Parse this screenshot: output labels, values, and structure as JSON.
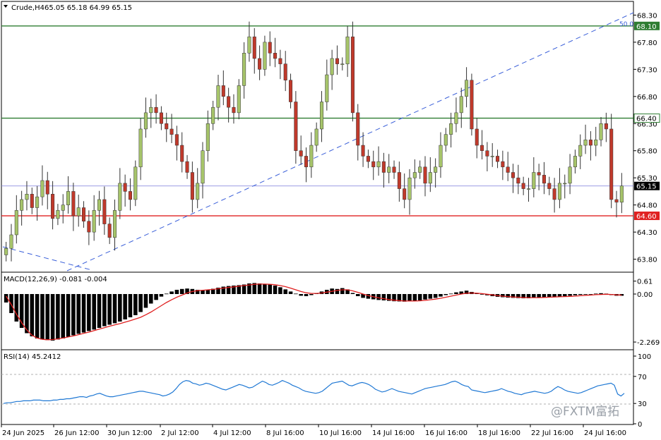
{
  "header": {
    "symbol": "Crude,H4",
    "ohlc": "65.05 65.18 64.99 65.15"
  },
  "indicators": {
    "macd_label": "MACD(12,26,9) -0.081 -0.004",
    "rsi_label": "RSI(14) 45.2412"
  },
  "watermark": "@FXTM富拓",
  "fib_label": "50.0",
  "colors": {
    "up_candle": "#a6c46a",
    "down_candle": "#c0392b",
    "green_line": "#2e7d32",
    "red_line": "#e02020",
    "price_line": "#7c7cdc",
    "trend_line": "#3a5fd9",
    "signal_line": "#e02020",
    "rsi_line": "#1f78d4"
  },
  "chart_data": [
    {
      "type": "candlestick",
      "title": "Crude,H4",
      "ylim": [
        63.6,
        68.5
      ],
      "y_ticks": [
        "68.30",
        "67.80",
        "67.30",
        "66.80",
        "66.30",
        "65.80",
        "65.30",
        "64.80",
        "64.30",
        "63.80"
      ],
      "x_ticks": [
        "24 Jun 2025",
        "26 Jun 12:00",
        "30 Jun 12:00",
        "2 Jul 12:00",
        "4 Jul 12:00",
        "8 Jul 16:00",
        "10 Jul 16:00",
        "14 Jul 16:00",
        "16 Jul 16:00",
        "18 Jul 16:00",
        "22 Jul 16:00",
        "24 Jul 16:00"
      ],
      "close_series": [
        64.0,
        64.25,
        64.7,
        64.9,
        65.0,
        64.75,
        64.95,
        65.25,
        65.0,
        64.55,
        64.7,
        64.8,
        65.05,
        64.6,
        64.75,
        64.5,
        64.3,
        64.7,
        64.9,
        64.45,
        64.2,
        64.7,
        65.2,
        65.05,
        64.9,
        65.5,
        66.2,
        66.5,
        66.6,
        66.5,
        66.3,
        66.2,
        66.1,
        65.9,
        65.6,
        65.4,
        64.9,
        65.2,
        65.8,
        66.3,
        66.6,
        67.0,
        66.8,
        66.6,
        66.5,
        67.0,
        67.6,
        67.9,
        67.5,
        67.3,
        67.8,
        67.6,
        67.5,
        67.4,
        67.1,
        66.7,
        65.8,
        65.7,
        65.5,
        65.9,
        66.2,
        66.7,
        67.2,
        67.5,
        67.4,
        67.4,
        67.9,
        66.5,
        65.9,
        65.7,
        65.6,
        65.5,
        65.6,
        65.4,
        65.5,
        65.4,
        65.1,
        64.9,
        65.3,
        65.4,
        65.5,
        65.2,
        65.4,
        65.5,
        65.9,
        66.1,
        66.3,
        66.5,
        66.8,
        67.1,
        66.2,
        65.9,
        65.8,
        65.7,
        65.7,
        65.6,
        65.5,
        65.4,
        65.3,
        65.2,
        65.1,
        65.1,
        65.4,
        65.35,
        65.2,
        65.1,
        64.9,
        65.2,
        65.2,
        65.5,
        65.7,
        65.9,
        66.0,
        65.9,
        66.0,
        66.3,
        66.2,
        64.9,
        64.85,
        65.15
      ],
      "horizontal_levels": [
        {
          "label": "68.10",
          "value": 68.1
        },
        {
          "label": "66.40",
          "value": 66.4
        },
        {
          "label": "65.15",
          "value": 65.15
        },
        {
          "label": "64.60",
          "value": 64.6
        }
      ]
    },
    {
      "type": "bar",
      "title": "MACD(12,26,9) -0.081 -0.004",
      "y_ticks": [
        "0.61",
        "0.00",
        "-2.269"
      ],
      "ylim": [
        -2.5,
        0.9
      ],
      "histogram": [
        -0.4,
        -0.9,
        -1.3,
        -1.6,
        -1.85,
        -2.0,
        -2.1,
        -2.15,
        -2.18,
        -2.2,
        -2.15,
        -2.1,
        -2.02,
        -1.95,
        -1.88,
        -1.82,
        -1.75,
        -1.68,
        -1.6,
        -1.52,
        -1.45,
        -1.38,
        -1.3,
        -1.2,
        -1.1,
        -1.0,
        -0.85,
        -0.65,
        -0.45,
        -0.28,
        -0.12,
        0.02,
        0.12,
        0.2,
        0.24,
        0.26,
        0.24,
        0.2,
        0.18,
        0.2,
        0.25,
        0.3,
        0.35,
        0.38,
        0.4,
        0.42,
        0.45,
        0.5,
        0.52,
        0.5,
        0.48,
        0.45,
        0.4,
        0.32,
        0.22,
        0.12,
        0.02,
        -0.08,
        -0.1,
        -0.05,
        0.05,
        0.12,
        0.2,
        0.26,
        0.24,
        0.28,
        0.22,
        0.05,
        -0.1,
        -0.18,
        -0.22,
        -0.25,
        -0.28,
        -0.3,
        -0.32,
        -0.34,
        -0.35,
        -0.36,
        -0.34,
        -0.32,
        -0.3,
        -0.26,
        -0.22,
        -0.18,
        -0.12,
        -0.05,
        0.02,
        0.08,
        0.12,
        0.16,
        0.1,
        0.04,
        -0.02,
        -0.06,
        -0.1,
        -0.13,
        -0.15,
        -0.17,
        -0.18,
        -0.19,
        -0.2,
        -0.2,
        -0.18,
        -0.16,
        -0.15,
        -0.14,
        -0.13,
        -0.12,
        -0.1,
        -0.08,
        -0.06,
        -0.04,
        -0.02,
        0.0,
        0.02,
        0.04,
        0.02,
        -0.05,
        -0.08,
        -0.08
      ],
      "signal": [
        -0.1,
        -0.5,
        -0.95,
        -1.35,
        -1.7,
        -1.95,
        -2.08,
        -2.14,
        -2.16,
        -2.15,
        -2.12,
        -2.08,
        -2.03,
        -1.98,
        -1.92,
        -1.86,
        -1.8,
        -1.73,
        -1.66,
        -1.59,
        -1.52,
        -1.46,
        -1.4,
        -1.33,
        -1.26,
        -1.18,
        -1.1,
        -0.98,
        -0.85,
        -0.7,
        -0.55,
        -0.4,
        -0.27,
        -0.15,
        -0.05,
        0.05,
        0.12,
        0.16,
        0.18,
        0.2,
        0.22,
        0.25,
        0.28,
        0.31,
        0.34,
        0.37,
        0.4,
        0.43,
        0.46,
        0.47,
        0.47,
        0.46,
        0.44,
        0.4,
        0.35,
        0.28,
        0.2,
        0.12,
        0.06,
        0.03,
        0.03,
        0.05,
        0.09,
        0.13,
        0.17,
        0.2,
        0.2,
        0.15,
        0.08,
        0.0,
        -0.07,
        -0.13,
        -0.18,
        -0.22,
        -0.26,
        -0.29,
        -0.31,
        -0.33,
        -0.33,
        -0.33,
        -0.32,
        -0.3,
        -0.27,
        -0.24,
        -0.2,
        -0.15,
        -0.1,
        -0.05,
        0.0,
        0.04,
        0.05,
        0.04,
        0.02,
        -0.01,
        -0.04,
        -0.07,
        -0.1,
        -0.12,
        -0.14,
        -0.15,
        -0.16,
        -0.17,
        -0.17,
        -0.17,
        -0.16,
        -0.15,
        -0.14,
        -0.13,
        -0.12,
        -0.11,
        -0.1,
        -0.08,
        -0.06,
        -0.05,
        -0.03,
        -0.02,
        -0.01,
        -0.02,
        -0.04,
        -0.05
      ]
    },
    {
      "type": "line",
      "title": "RSI(14) 45.2412",
      "y_ticks": [
        "100",
        "70",
        "30",
        "0"
      ],
      "ylim": [
        0,
        100
      ],
      "values": [
        30,
        31,
        31,
        32,
        33,
        33,
        34,
        34,
        34,
        35,
        35,
        35,
        34,
        34,
        34,
        35,
        35,
        36,
        36,
        37,
        37,
        38,
        39,
        40,
        40,
        39,
        41,
        42,
        44,
        45,
        43,
        41,
        40,
        40,
        41,
        42,
        43,
        44,
        45,
        46,
        47,
        48,
        48,
        47,
        46,
        45,
        44,
        43,
        41,
        42,
        44,
        47,
        52,
        58,
        62,
        64,
        63,
        60,
        59,
        57,
        58,
        60,
        59,
        57,
        55,
        53,
        51,
        50,
        52,
        54,
        56,
        58,
        57,
        55,
        53,
        54,
        57,
        60,
        63,
        61,
        58,
        57,
        59,
        61,
        64,
        62,
        60,
        57,
        55,
        53,
        50,
        48,
        47,
        46,
        45,
        46,
        48,
        52,
        56,
        60,
        61,
        62,
        63,
        60,
        57,
        56,
        58,
        60,
        61,
        60,
        58,
        55,
        51,
        49,
        47,
        48,
        50,
        52,
        50,
        48,
        47,
        46,
        45,
        44,
        46,
        48,
        50,
        52,
        53,
        54,
        55,
        56,
        57,
        58,
        60,
        62,
        63,
        61,
        58,
        56,
        55,
        50,
        49,
        48,
        47,
        46,
        47,
        48,
        49,
        50,
        52,
        50,
        48,
        47,
        45,
        44,
        43,
        45,
        46,
        47,
        48,
        47,
        46,
        45,
        46,
        48,
        52,
        55,
        53,
        50,
        48,
        47,
        46,
        45,
        46,
        48,
        50,
        52,
        54,
        56,
        57,
        58,
        59,
        60,
        57,
        44,
        41,
        45
      ]
    }
  ]
}
